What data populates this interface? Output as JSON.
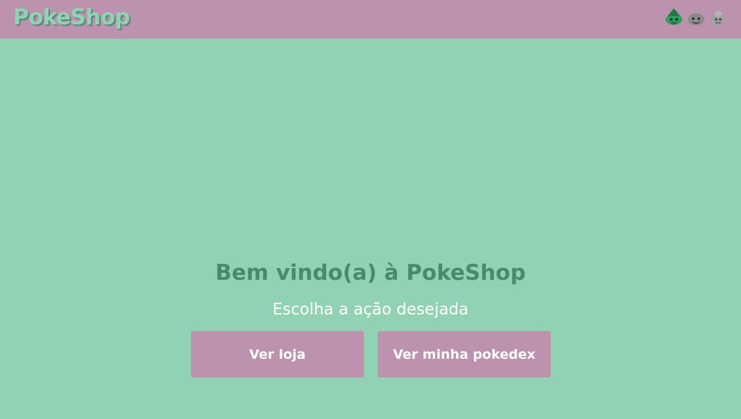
{
  "header": {
    "brand": "PokeShop",
    "icons": [
      {
        "name": "bulbasaur-icon",
        "color": "#2e9e5b"
      },
      {
        "name": "geodude-icon",
        "color": "#8c8c8c"
      },
      {
        "name": "onix-icon",
        "color": "#a0a0a0"
      }
    ]
  },
  "main": {
    "title": "Bem vindo(a) à PokeShop",
    "subtitle": "Escolha a ação desejada",
    "buttons": {
      "shop_label": "Ver loja",
      "pokedex_label": "Ver minha pokedex"
    }
  },
  "colors": {
    "background": "#92d2b4",
    "header": "#bd92ae",
    "button": "#bd92ae",
    "title": "#4a8a6c"
  }
}
